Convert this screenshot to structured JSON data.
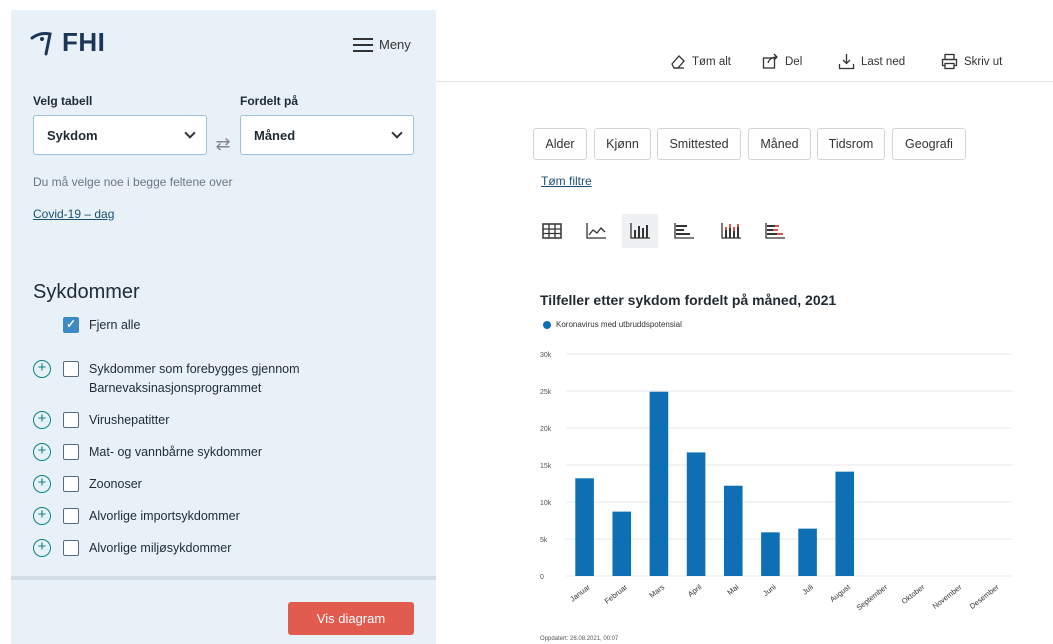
{
  "header": {
    "logo_text": "FHI",
    "menu_label": "Meny"
  },
  "controls": {
    "table_label": "Velg tabell",
    "table_value": "Sykdom",
    "split_label": "Fordelt på",
    "split_value": "Måned",
    "hint": "Du må velge noe i begge feltene over",
    "covid_link": "Covid-19 – dag"
  },
  "diseases": {
    "title": "Sykdommer",
    "remove_all": "Fjern alle",
    "items": [
      {
        "label_line1": "Sykdommer som forebygges gjennom",
        "label_line2": "Barnevaksinasjonsprogrammet"
      },
      {
        "label_line1": "Virushepatitter"
      },
      {
        "label_line1": "Mat- og vannbårne sykdommer"
      },
      {
        "label_line1": "Zoonoser"
      },
      {
        "label_line1": "Alvorlige importsykdommer"
      },
      {
        "label_line1": "Alvorlige miljøsykdommer"
      }
    ]
  },
  "footer": {
    "vis_button": "Vis diagram"
  },
  "toolbar": {
    "clear_all": "Tøm alt",
    "share": "Del",
    "download": "Last ned",
    "print": "Skriv ut"
  },
  "filters": {
    "tabs": [
      "Alder",
      "Kjønn",
      "Smittested",
      "Måned",
      "Tidsrom",
      "Geografi"
    ],
    "clear_filters": "Tøm filtre"
  },
  "chart_types": [
    "table-icon",
    "line-chart-icon",
    "bar-chart-icon",
    "horizontal-bar-icon",
    "stacked-bar-icon",
    "stacked-horizontal-bar-icon"
  ],
  "updated_text": "Oppdatert: 26.08.2021, 00:07",
  "colors": {
    "accent": "#0e6fb5",
    "button": "#e15b4f",
    "sidebar": "#e8f1f8"
  },
  "chart_data": {
    "type": "bar",
    "title": "Tilfeller etter sykdom fordelt på måned, 2021",
    "categories": [
      "Januar",
      "Februar",
      "Mars",
      "April",
      "Mai",
      "Juni",
      "Juli",
      "August",
      "September",
      "Oktober",
      "November",
      "Desember"
    ],
    "series": [
      {
        "name": "Koronavirus med utbruddspotensial",
        "values": [
          13200,
          8700,
          24900,
          16700,
          12200,
          5900,
          6400,
          14100,
          0,
          0,
          0,
          0
        ]
      }
    ],
    "ylim": [
      0,
      30000
    ],
    "yticks": [
      "0",
      "5k",
      "10k",
      "15k",
      "20k",
      "25k",
      "30k"
    ],
    "xlabel": "",
    "ylabel": "",
    "grid": true,
    "legend": "top-left"
  }
}
